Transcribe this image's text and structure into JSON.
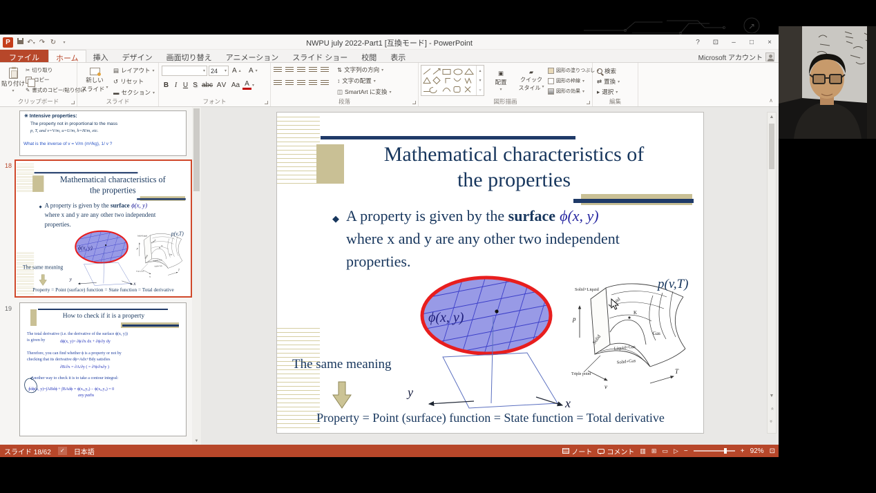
{
  "titlebar": {
    "title": "NWPU july 2022-Part1 [互換モード] - PowerPoint",
    "help": "?"
  },
  "account": {
    "label": "Microsoft アカウント"
  },
  "tabs": {
    "file": "ファイル",
    "items": [
      "ホーム",
      "挿入",
      "デザイン",
      "画面切り替え",
      "アニメーション",
      "スライド ショー",
      "校閲",
      "表示"
    ]
  },
  "ribbon": {
    "clipboard": {
      "label": "クリップボード",
      "paste": "貼り付け",
      "cut": "切り取り",
      "copy": "コピー",
      "painter": "書式のコピー/貼り付け"
    },
    "slides": {
      "label": "スライド",
      "new1": "新しい",
      "new2": "スライド",
      "layout": "レイアウト",
      "reset": "リセット",
      "section": "セクション"
    },
    "font": {
      "label": "フォント",
      "size": "24",
      "bold": "B",
      "italic": "I",
      "underline": "U",
      "shadow": "S",
      "strike": "abc",
      "spacing": "AV",
      "case": "Aa",
      "color": "A",
      "grow": "A",
      "shrink": "A"
    },
    "paragraph": {
      "label": "段落",
      "direction": "文字列の方向",
      "align_text": "文字の配置",
      "smartart": "SmartArt に変換"
    },
    "drawing": {
      "label": "図形描画",
      "arrange": "配置",
      "quick1": "クイック",
      "quick2": "スタイル",
      "fill": "図形の塗りつぶし",
      "outline": "図形の枠線",
      "effects": "図形の効果"
    },
    "editing": {
      "label": "編集",
      "find": "検索",
      "replace": "置換",
      "select": "選択"
    }
  },
  "icons": {
    "logo": "P",
    "dropdown": "▾",
    "undo": "↶",
    "redo": "↷",
    "repeat": "↻",
    "ribbon_display": "⊡",
    "minimize": "–",
    "restore": "□",
    "close": "×",
    "cut": "✂",
    "painter": "✎",
    "layout": "▤",
    "reset": "↺",
    "section": "▬",
    "direction": "⇅",
    "align_text": "↕",
    "smartart": "◫",
    "arrange": "▣",
    "quick": "▰",
    "replace": "⇄",
    "select": "▸",
    "collapse": "∧",
    "scroll_up": "▲",
    "scroll_down": "▼",
    "chevron": "«",
    "gallery_up": "▴",
    "gallery_down": "▾",
    "gallery_more": "▿",
    "spell": "✓",
    "view_normal": "▥",
    "view_sorter": "⊞",
    "view_reading": "▭",
    "view_slideshow": "▷",
    "zoom_out": "−",
    "zoom_in": "+",
    "fit": "⊡"
  },
  "panel": {
    "num18": "18",
    "num19": "19",
    "slide17": {
      "l1": "✳ Intensive properties:",
      "l2": "The property not in proportional to the mass",
      "l3": "p, T, and v=V/m, u=U/m, h=H/m, etc.",
      "l4": "What is the inverse of v = V/m  (m³/kg), 1/ v ?"
    },
    "slide19": {
      "title": "How to check if it is a property",
      "b1": "The total derivative (i.e. the derivative of the surface ϕ(x, y))",
      "b1b": "is given by",
      "f1": "dϕ(x, y)= ∂ϕ/∂x dx + ∂ϕ/∂y dy",
      "b2a": "Therefore, you can find whether ϕ is a property or not by",
      "b2b": "checking that its derivative  dϕ=Adx+Bdy  satisfies",
      "f2": "∂B/∂x = ∂A/∂y ( = ∂²ϕ/∂x∂y )",
      "b3": "Another way to check it is to take a contour integral:",
      "f3": "∮dϕ(x, y)=∫ABdϕ + ∫BAdϕ = ϕ(x₀,y₀) − ϕ(x₀,y₀) = 0",
      "note": "any paths"
    }
  },
  "slide": {
    "title1": "Mathematical characteristics of",
    "title2": "the properties",
    "bullet": "◆",
    "b_pre": "A property is given by the ",
    "b_bold": "surface",
    "b_math": "ϕ(x, y)",
    "b_l2": "where x and y are any other two independent",
    "b_l3": "properties.",
    "phi": "ϕ(x, y)",
    "same": "The same meaning",
    "x": "x",
    "y": "y",
    "bottom": "Property = Point (surface) function = State function = Total derivative",
    "pvt": "p(v,T)",
    "d3": {
      "sl": "Solid+Liquid",
      "liq": "Liquid",
      "k": "K",
      "sol": "Solid",
      "gas": "Gas",
      "lg": "Liquid+Gas",
      "sg": "Solid+Gas",
      "tp": "Triple point",
      "p": "p",
      "v": "v",
      "t": "T"
    }
  },
  "statusbar": {
    "counter": "スライド 18/62",
    "lang": "日本語",
    "notes": "ノート",
    "comments": "コメント",
    "zoom": "92%"
  }
}
